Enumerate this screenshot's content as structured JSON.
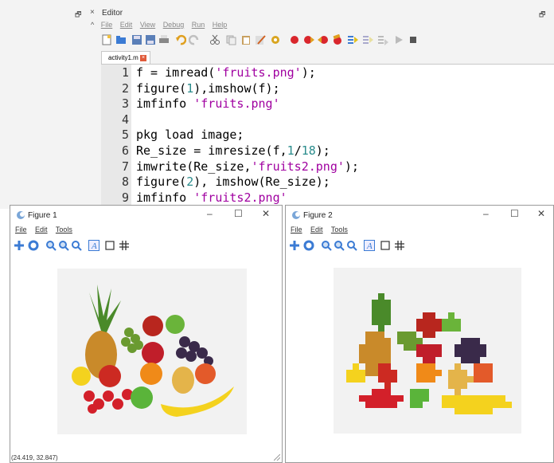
{
  "editor": {
    "title": "Editor",
    "restore_glyph": "🗗",
    "close_glyph": "×",
    "menu": [
      "File",
      "Edit",
      "View",
      "Debug",
      "Run",
      "Help"
    ],
    "tab_label": "activity1.m",
    "tab_close_glyph": "×",
    "lines": [
      {
        "num": "1",
        "text": "f = imread('fruits.png');"
      },
      {
        "num": "2",
        "text": "figure(1),imshow(f);"
      },
      {
        "num": "3",
        "text": "imfinfo 'fruits.png'"
      },
      {
        "num": "4",
        "text": ""
      },
      {
        "num": "5",
        "text": "pkg load image;"
      },
      {
        "num": "6",
        "text": "Re_size = imresize(f,1/18);"
      },
      {
        "num": "7",
        "text": "imwrite(Re_size,'fruits2.png');"
      },
      {
        "num": "8",
        "text": "figure(2), imshow(Re_size);"
      },
      {
        "num": "9",
        "text": "imfinfo 'fruits2.png'"
      }
    ]
  },
  "figure1": {
    "title": "Figure 1",
    "menu": [
      "File",
      "Edit",
      "Tools"
    ],
    "status": "(24.419, 32.847)"
  },
  "figure2": {
    "title": "Figure 2",
    "menu": [
      "File",
      "Edit",
      "Tools"
    ]
  },
  "window_buttons": {
    "minimize": "–",
    "maximize": "☐",
    "close": "✕"
  },
  "colors": {
    "string": "#a000a0",
    "number": "#2a8c8c",
    "record": "#d9262c",
    "tab_close": "#e05a3a"
  }
}
